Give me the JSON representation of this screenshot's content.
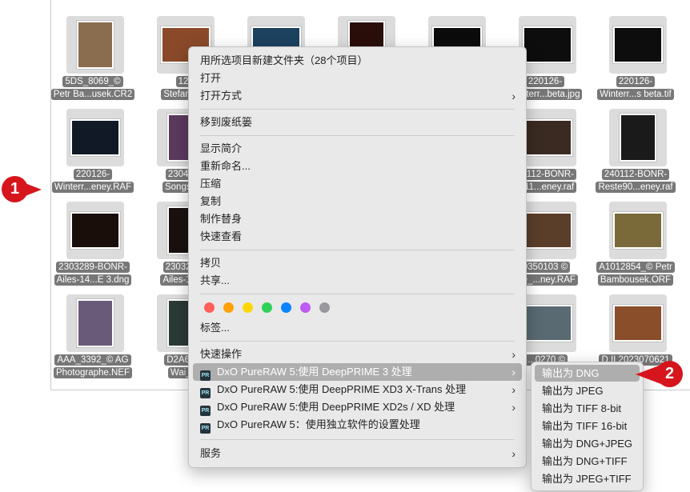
{
  "files": [
    {
      "line1": "5DS_8069_©",
      "line2": "Petr Ba...usek.CR2"
    },
    {
      "line1": "12",
      "line2": "Stefan_fo"
    },
    {
      "line1": "",
      "line2": ""
    },
    {
      "line1": "",
      "line2": ""
    },
    {
      "line1": "",
      "line2": ""
    },
    {
      "line1": "220126-",
      "line2": "Winterr...beta.jpg"
    },
    {
      "line1": "220126-",
      "line2": "Winterr...s beta.tif"
    },
    {
      "line1": "220126-",
      "line2": "Winterr...eney.RAF"
    },
    {
      "line1": "230425",
      "line2": "Songs-..."
    },
    {
      "line1": "",
      "line2": ""
    },
    {
      "line1": "",
      "line2": ""
    },
    {
      "line1": "",
      "line2": ""
    },
    {
      "line1": "40112-BONR-",
      "line2": "e-11...eney.raf"
    },
    {
      "line1": "240112-BONR-",
      "line2": "Reste90...eney.raf"
    },
    {
      "line1": "2303289-BONR-",
      "line2": "Ailes-14...E 3.dng"
    },
    {
      "line1": "2303289",
      "line2": "Ailes-14..."
    },
    {
      "line1": "",
      "line2": ""
    },
    {
      "line1": "",
      "line2": ""
    },
    {
      "line1": "",
      "line2": ""
    },
    {
      "line1": "0350103 ©",
      "line2": "the_...ney.RAF"
    },
    {
      "line1": "A1012854_© Petr",
      "line2": "Bambousek.ORF"
    },
    {
      "line1": "AAA_3392_© AG",
      "line2": "Photographe.NEF"
    },
    {
      "line1": "D2A686",
      "line2": "Wai_L"
    },
    {
      "line1": "",
      "line2": ""
    },
    {
      "line1": "",
      "line2": ""
    },
    {
      "line1": "",
      "line2": ""
    },
    {
      "line1": "... 0270 ©",
      "line2": ""
    },
    {
      "line1": "D.II 2023070621",
      "line2": ""
    }
  ],
  "context_menu": {
    "new_folder": "用所选项目新建文件夹（28个项目）",
    "open": "打开",
    "open_with": "打开方式",
    "move_to_trash": "移到废纸篓",
    "get_info": "显示简介",
    "rename": "重新命名...",
    "compress": "压缩",
    "duplicate": "复制",
    "make_alias": "制作替身",
    "quick_look": "快速查看",
    "copy": "拷贝",
    "share": "共享...",
    "tags": "标签...",
    "quick_actions": "快速操作",
    "dxo_item_1": "DxO PureRAW 5:使用 DeepPRIME 3 处理",
    "dxo_item_2": "DxO PureRAW 5:使用 DeepPRIME XD3 X-Trans 处理",
    "dxo_item_3": "DxO PureRAW 5:使用 DeepPRIME XD2s / XD 处理",
    "dxo_item_4": "DxO PureRAW 5：使用独立软件的设置处理",
    "services": "服务",
    "pr_badge": "PR",
    "tag_colors": [
      "#ff5f57",
      "#ff9f0a",
      "#ffd60a",
      "#30d158",
      "#0a84ff",
      "#bf5af2",
      "#98989d"
    ]
  },
  "submenu": [
    "输出为 DNG",
    "输出为 JPEG",
    "输出为 TIFF 8-bit",
    "输出为 TIFF 16-bit",
    "输出为 DNG+JPEG",
    "输出为 DNG+TIFF",
    "输出为 JPEG+TIFF"
  ],
  "callouts": {
    "one": "1",
    "two": "2"
  },
  "accent": "#d6151c"
}
